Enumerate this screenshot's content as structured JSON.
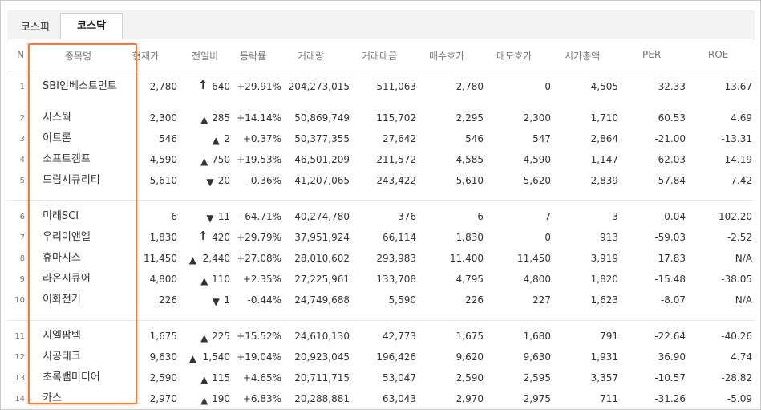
{
  "tabs": [
    {
      "label": "코스피",
      "active": false
    },
    {
      "label": "코스닥",
      "active": true
    }
  ],
  "columns": [
    "N",
    "종목명",
    "현재가",
    "전일비",
    "등락률",
    "거래량",
    "거래대금",
    "매수호가",
    "매도호가",
    "시가총액",
    "PER",
    "ROE"
  ],
  "colors": {
    "up": "#e01010",
    "down": "#1060d0",
    "highlight": "#f07a40"
  },
  "rows": [
    {
      "n": "1",
      "name": "SBI인베스트먼트",
      "price": "2,780",
      "dir": "limit-up",
      "change": "640",
      "rate": "+29.91%",
      "volume": "204,273,015",
      "amount": "511,063",
      "bid": "2,780",
      "ask": "0",
      "cap": "4,505",
      "per": "32.33",
      "roe": "13.67"
    },
    {
      "n": "2",
      "name": "시스웍",
      "price": "2,300",
      "dir": "up",
      "change": "285",
      "rate": "+14.14%",
      "volume": "50,869,749",
      "amount": "115,702",
      "bid": "2,295",
      "ask": "2,300",
      "cap": "1,710",
      "per": "60.53",
      "roe": "4.69"
    },
    {
      "n": "3",
      "name": "이트론",
      "price": "546",
      "dir": "up",
      "change": "2",
      "rate": "+0.37%",
      "volume": "50,377,355",
      "amount": "27,642",
      "bid": "546",
      "ask": "547",
      "cap": "2,864",
      "per": "-21.00",
      "roe": "-13.31"
    },
    {
      "n": "4",
      "name": "소프트캠프",
      "price": "4,590",
      "dir": "up",
      "change": "750",
      "rate": "+19.53%",
      "volume": "46,501,209",
      "amount": "211,572",
      "bid": "4,585",
      "ask": "4,590",
      "cap": "1,147",
      "per": "62.03",
      "roe": "14.19"
    },
    {
      "n": "5",
      "name": "드림시큐리티",
      "price": "5,610",
      "dir": "down",
      "change": "20",
      "rate": "-0.36%",
      "volume": "41,207,065",
      "amount": "243,422",
      "bid": "5,610",
      "ask": "5,620",
      "cap": "2,839",
      "per": "57.84",
      "roe": "7.42"
    },
    {
      "n": "6",
      "name": "미래SCI",
      "price": "6",
      "dir": "down",
      "change": "11",
      "rate": "-64.71%",
      "volume": "40,274,780",
      "amount": "376",
      "bid": "6",
      "ask": "7",
      "cap": "3",
      "per": "-0.04",
      "roe": "-102.20"
    },
    {
      "n": "7",
      "name": "우리이앤엘",
      "price": "1,830",
      "dir": "limit-up",
      "change": "420",
      "rate": "+29.79%",
      "volume": "37,951,924",
      "amount": "66,114",
      "bid": "1,830",
      "ask": "0",
      "cap": "913",
      "per": "-59.03",
      "roe": "-2.52"
    },
    {
      "n": "8",
      "name": "휴마시스",
      "price": "11,450",
      "dir": "up",
      "change": "2,440",
      "rate": "+27.08%",
      "volume": "28,010,602",
      "amount": "293,983",
      "bid": "11,400",
      "ask": "11,450",
      "cap": "3,919",
      "per": "17.83",
      "roe": "N/A"
    },
    {
      "n": "9",
      "name": "라온시큐어",
      "price": "4,800",
      "dir": "up",
      "change": "110",
      "rate": "+2.35%",
      "volume": "27,225,961",
      "amount": "133,708",
      "bid": "4,795",
      "ask": "4,800",
      "cap": "1,820",
      "per": "-15.48",
      "roe": "-38.05"
    },
    {
      "n": "10",
      "name": "이화전기",
      "price": "226",
      "dir": "down",
      "change": "1",
      "rate": "-0.44%",
      "volume": "24,749,688",
      "amount": "5,590",
      "bid": "226",
      "ask": "227",
      "cap": "1,623",
      "per": "-8.07",
      "roe": "N/A"
    },
    {
      "n": "11",
      "name": "지엘팜텍",
      "price": "1,675",
      "dir": "up",
      "change": "225",
      "rate": "+15.52%",
      "volume": "24,610,130",
      "amount": "42,773",
      "bid": "1,675",
      "ask": "1,680",
      "cap": "791",
      "per": "-22.64",
      "roe": "-40.26"
    },
    {
      "n": "12",
      "name": "시공테크",
      "price": "9,630",
      "dir": "up",
      "change": "1,540",
      "rate": "+19.04%",
      "volume": "20,923,045",
      "amount": "196,426",
      "bid": "9,620",
      "ask": "9,630",
      "cap": "1,931",
      "per": "36.90",
      "roe": "4.74"
    },
    {
      "n": "13",
      "name": "초록뱀미디어",
      "price": "2,590",
      "dir": "up",
      "change": "115",
      "rate": "+4.65%",
      "volume": "20,711,715",
      "amount": "53,047",
      "bid": "2,590",
      "ask": "2,595",
      "cap": "3,357",
      "per": "-10.57",
      "roe": "-28.82"
    },
    {
      "n": "14",
      "name": "카스",
      "price": "2,970",
      "dir": "up",
      "change": "190",
      "rate": "+6.83%",
      "volume": "20,288,881",
      "amount": "63,043",
      "bid": "2,970",
      "ask": "2,975",
      "cap": "711",
      "per": "-31.26",
      "roe": "-5.09"
    }
  ]
}
